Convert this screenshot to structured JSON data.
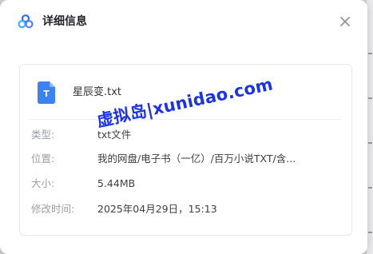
{
  "dialog": {
    "title": "详细信息",
    "close_icon": "close-icon",
    "logo_icon": "baidu-netdisk-logo-icon"
  },
  "file": {
    "icon": "txt-file-icon",
    "icon_letter": "T",
    "name": "星辰变.txt"
  },
  "details": [
    {
      "label": "类型:",
      "value": "txt文件"
    },
    {
      "label": "位置:",
      "value": "我的网盘/电子书（一亿）/百万小说TXT/含..."
    },
    {
      "label": "大小:",
      "value": "5.44MB"
    },
    {
      "label": "修改时间:",
      "value": "2025年04月29日，15:13"
    }
  ],
  "watermark": {
    "text": "虚拟岛|xunidao.com"
  },
  "colors": {
    "accent_blue": "#3b82f6",
    "watermark_blue": "#1b33e8"
  }
}
